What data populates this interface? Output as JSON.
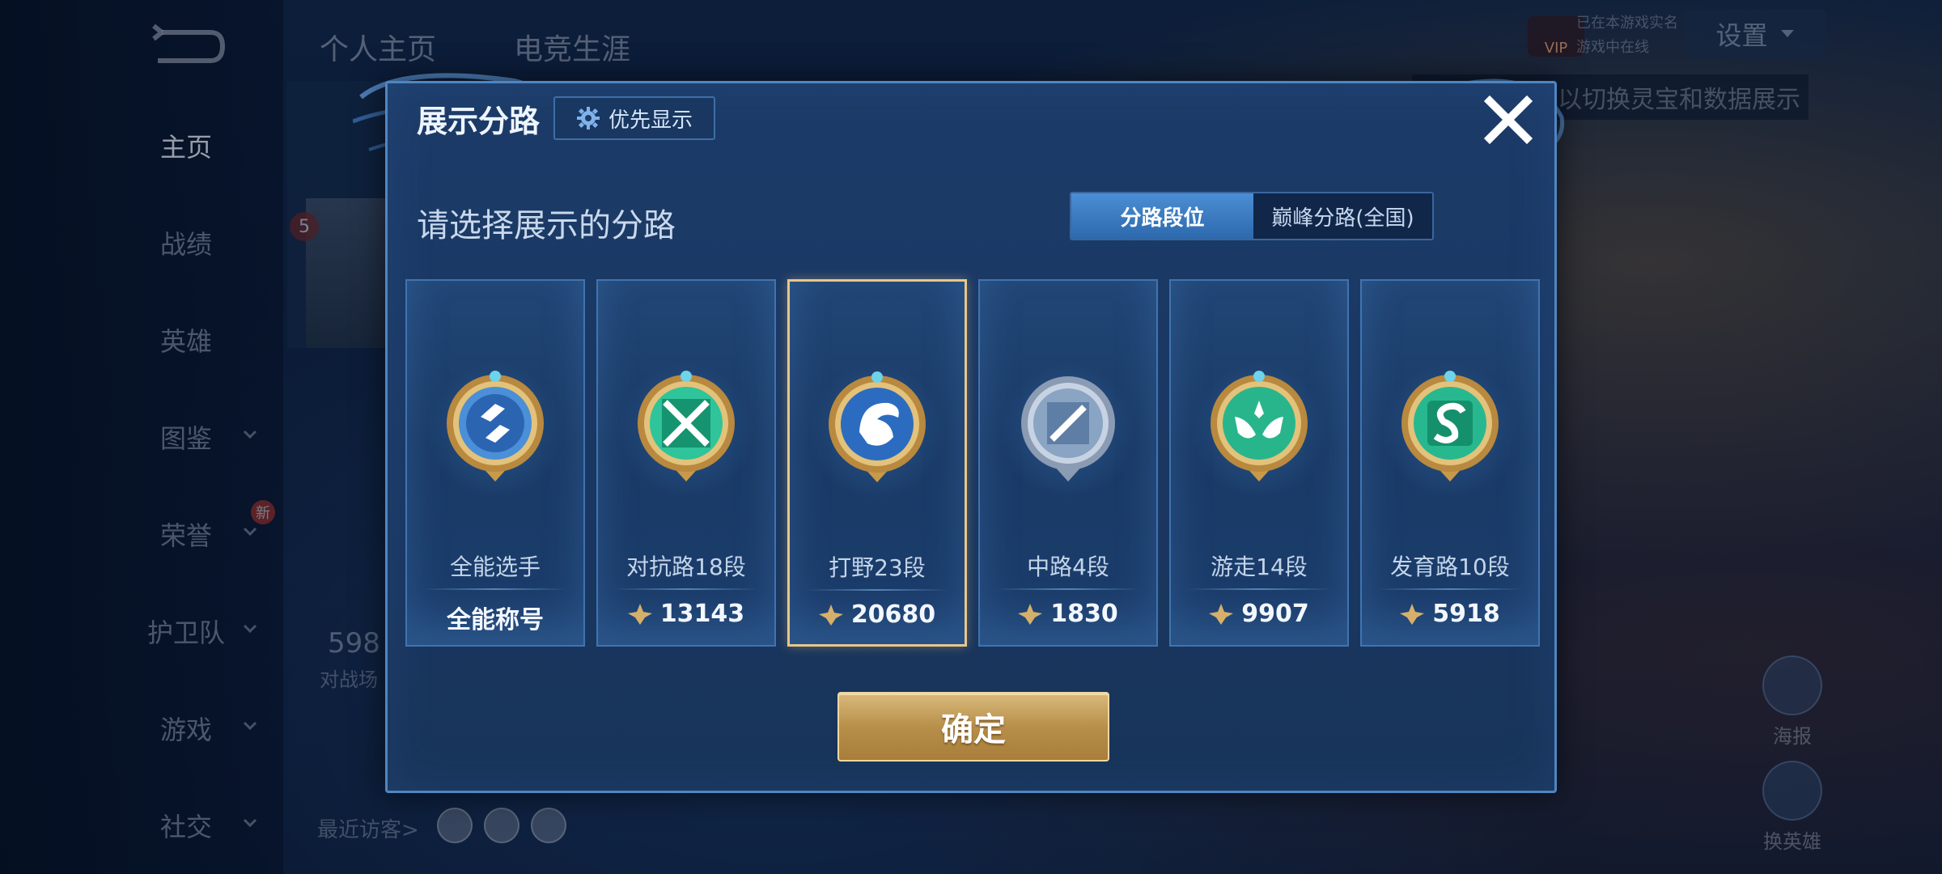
{
  "header": {
    "tabs": [
      "个人主页",
      "电竞生涯"
    ]
  },
  "sidebar": {
    "items": [
      {
        "label": "主页",
        "active": true,
        "chevron": false
      },
      {
        "label": "战绩",
        "chevron": false
      },
      {
        "label": "英雄",
        "chevron": false
      },
      {
        "label": "图鉴",
        "chevron": true
      },
      {
        "label": "荣誉",
        "chevron": true,
        "badge": "新"
      },
      {
        "label": "护卫队",
        "chevron": true
      },
      {
        "label": "游戏",
        "chevron": true
      },
      {
        "label": "社交",
        "chevron": true
      }
    ]
  },
  "background": {
    "rank_number": "5",
    "score": "598",
    "score_sub": "对战场",
    "recent_visitors": "最近访客>",
    "vip_label": "VIP",
    "status_line1": "已在本游戏实名",
    "status_line2": "游戏中在线",
    "settings_label": "设置",
    "hint_text": "以切换灵宝和数据展示",
    "right_actions": [
      "海报",
      "换英雄"
    ]
  },
  "dialog": {
    "title": "展示分路",
    "priority_label": "优先显示",
    "select_label": "请选择展示的分路",
    "toggle": {
      "options": [
        "分路段位",
        "巅峰分路(全国)"
      ],
      "active_index": 0
    },
    "lanes": [
      {
        "name": "全能选手",
        "value": "全能称号",
        "show_icon": false,
        "emblem": "all-round-emblem-icon",
        "color": "#4a8fd8",
        "selected": false
      },
      {
        "name": "对抗路18段",
        "value": "13143",
        "show_icon": true,
        "emblem": "clash-lane-emblem-icon",
        "color": "#2fc49a",
        "selected": false
      },
      {
        "name": "打野23段",
        "value": "20680",
        "show_icon": true,
        "emblem": "jungle-emblem-icon",
        "color": "#2c6cc0",
        "selected": true
      },
      {
        "name": "中路4段",
        "value": "1830",
        "show_icon": true,
        "emblem": "mid-lane-emblem-icon",
        "color": "#8aa4c4",
        "selected": false
      },
      {
        "name": "游走14段",
        "value": "9907",
        "show_icon": true,
        "emblem": "roam-emblem-icon",
        "color": "#29b58c",
        "selected": false
      },
      {
        "name": "发育路10段",
        "value": "5918",
        "show_icon": true,
        "emblem": "farm-lane-emblem-icon",
        "color": "#28b890",
        "selected": false
      }
    ],
    "confirm_label": "确定"
  },
  "colors": {
    "dialog_border": "#4f86c2",
    "selected_border": "#e8c68a",
    "gold": "#c9a25c"
  }
}
